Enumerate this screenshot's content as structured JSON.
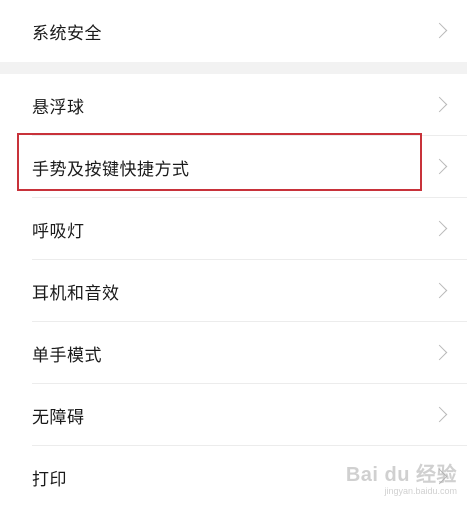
{
  "settings": {
    "group1": [
      {
        "label": "系统安全"
      }
    ],
    "group2": [
      {
        "label": "悬浮球"
      },
      {
        "label": "手势及按键快捷方式"
      },
      {
        "label": "呼吸灯"
      },
      {
        "label": "耳机和音效"
      },
      {
        "label": "单手模式"
      },
      {
        "label": "无障碍"
      },
      {
        "label": "打印"
      }
    ]
  },
  "highlight_color": "#c8323a",
  "watermark": {
    "brand": "Bai du 经验",
    "sub": "jingyan.baidu.com"
  }
}
